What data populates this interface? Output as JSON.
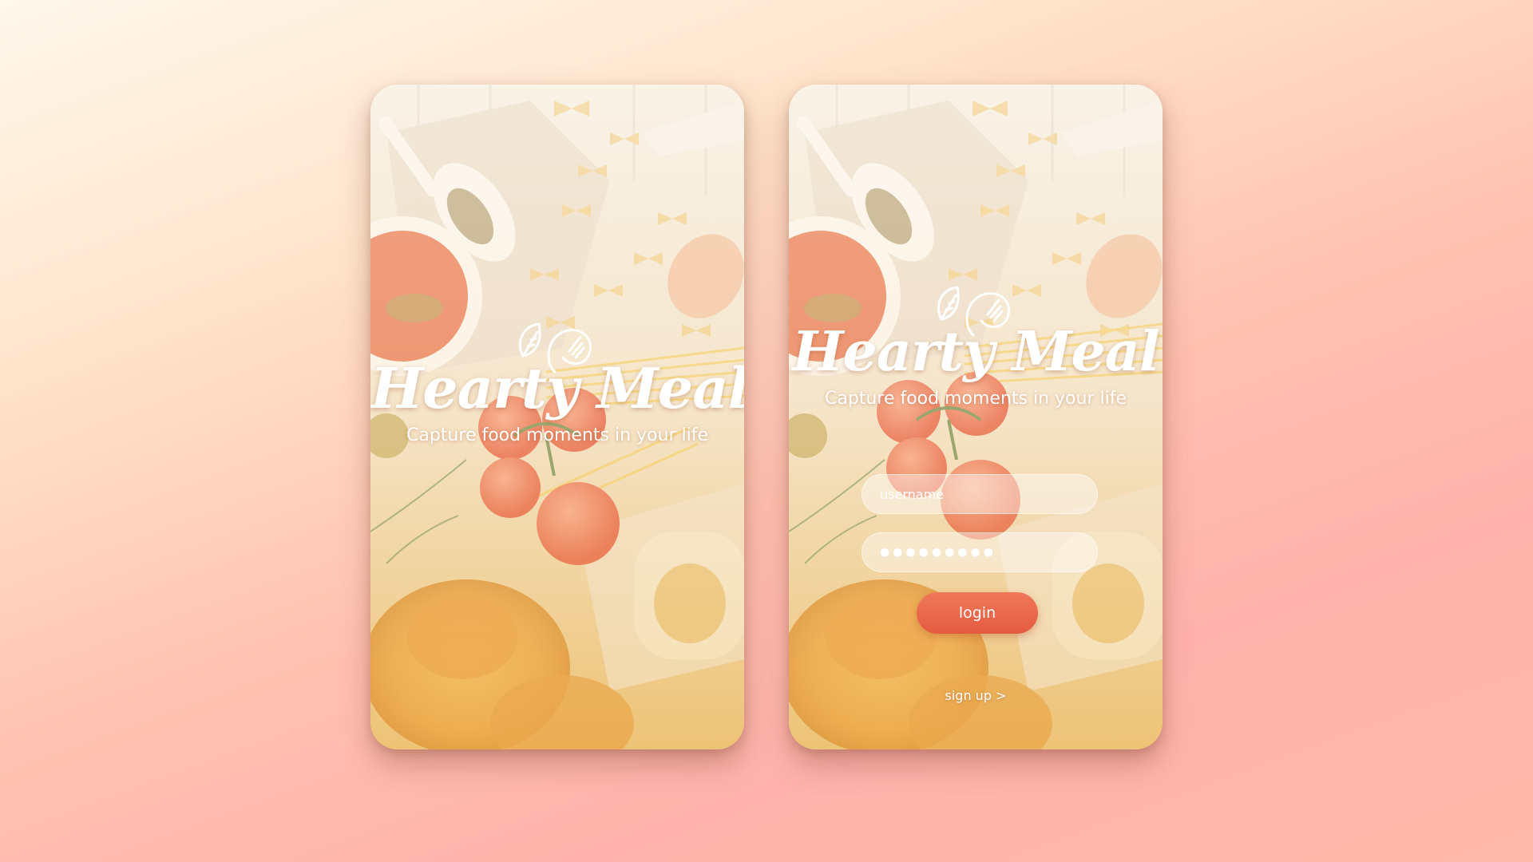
{
  "colors": {
    "accent": "#e8644a",
    "text_on_image": "#ffffff"
  },
  "splash_screen": {
    "logo_icon": "leaf-and-fork-icon",
    "brand_name": "Hearty Meal",
    "tagline": "Capture food moments in your life"
  },
  "login_screen": {
    "logo_icon": "leaf-and-fork-icon",
    "brand_name": "Hearty Meal",
    "tagline": "Capture food moments in your life",
    "username_placeholder": "username",
    "password_value": "●●●●●●●●●",
    "login_label": "login",
    "signup_label": "sign up >"
  }
}
